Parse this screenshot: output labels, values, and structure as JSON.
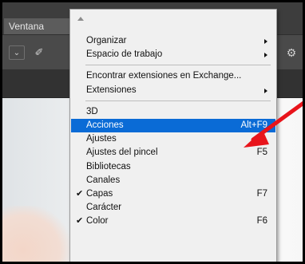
{
  "menubar": {
    "active_menu": "Ventana"
  },
  "menu": {
    "groups": [
      [
        {
          "label": "Organizar",
          "submenu": true
        },
        {
          "label": "Espacio de trabajo",
          "submenu": true
        }
      ],
      [
        {
          "label": "Encontrar extensiones en Exchange..."
        },
        {
          "label": "Extensiones",
          "submenu": true
        }
      ],
      [
        {
          "label": "3D"
        },
        {
          "label": "Acciones",
          "shortcut": "Alt+F9",
          "selected": true
        },
        {
          "label": "Ajustes"
        },
        {
          "label": "Ajustes del pincel",
          "shortcut": "F5"
        },
        {
          "label": "Bibliotecas"
        },
        {
          "label": "Canales"
        },
        {
          "label": "Capas",
          "shortcut": "F7",
          "checked": true
        },
        {
          "label": "Carácter"
        },
        {
          "label": "Color",
          "shortcut": "F6",
          "checked": true
        }
      ]
    ]
  },
  "icons": {
    "options_dropdown": "chevron-down-icon",
    "brush": "brush-icon",
    "settings": "gear-icon",
    "scroll_up": "scroll-up-icon",
    "check": "checkmark-icon",
    "submenu": "submenu-arrow-icon",
    "annotation": "red-arrow-icon"
  },
  "colors": {
    "menu_bg": "#f0f0f0",
    "highlight": "#0a6bd6",
    "annotation": "#e8141b"
  }
}
